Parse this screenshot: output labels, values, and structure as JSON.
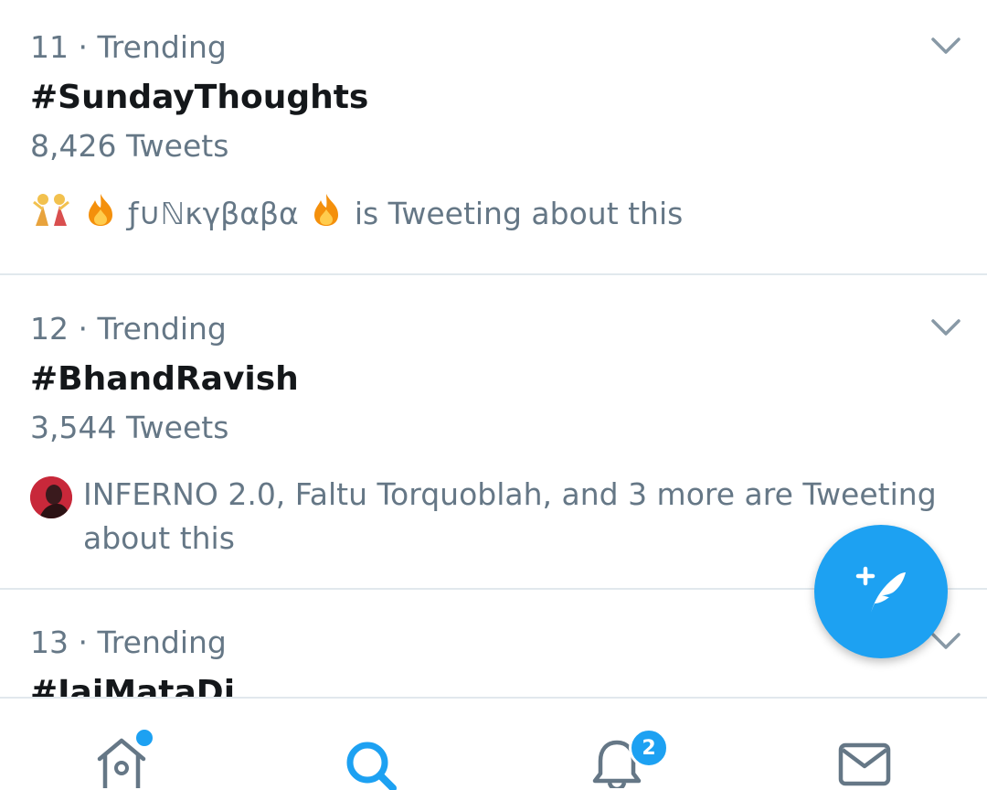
{
  "trends": [
    {
      "rank": "11",
      "separator": "·",
      "label": "Trending",
      "hashtag": "#SundayThoughts",
      "count": "8,426 Tweets",
      "context_name": "ƒ∪ℕκγβαβα",
      "context_suffix": "is Tweeting about this"
    },
    {
      "rank": "12",
      "separator": "·",
      "label": "Trending",
      "hashtag": "#BhandRavish",
      "count": "3,544 Tweets",
      "context_line1": "INFERNO 2.0, Faltu Torquoblah, and 3 more are Tweeting",
      "context_line2": "about this"
    },
    {
      "rank": "13",
      "separator": "·",
      "label": "Trending",
      "hashtag": "#JaiMataDi"
    }
  ],
  "fab": {
    "icon": "compose-tweet-icon"
  },
  "tabbar": {
    "tabs": [
      {
        "icon": "home-icon",
        "active": false
      },
      {
        "icon": "search-icon",
        "active": true
      },
      {
        "icon": "notifications-icon",
        "active": false
      },
      {
        "icon": "messages-icon",
        "active": false
      }
    ],
    "notifications_badge": "2"
  },
  "colors": {
    "accent": "#1da1f2",
    "text_primary": "#14171a",
    "text_secondary": "#657786",
    "divider": "#e1e8ed"
  }
}
